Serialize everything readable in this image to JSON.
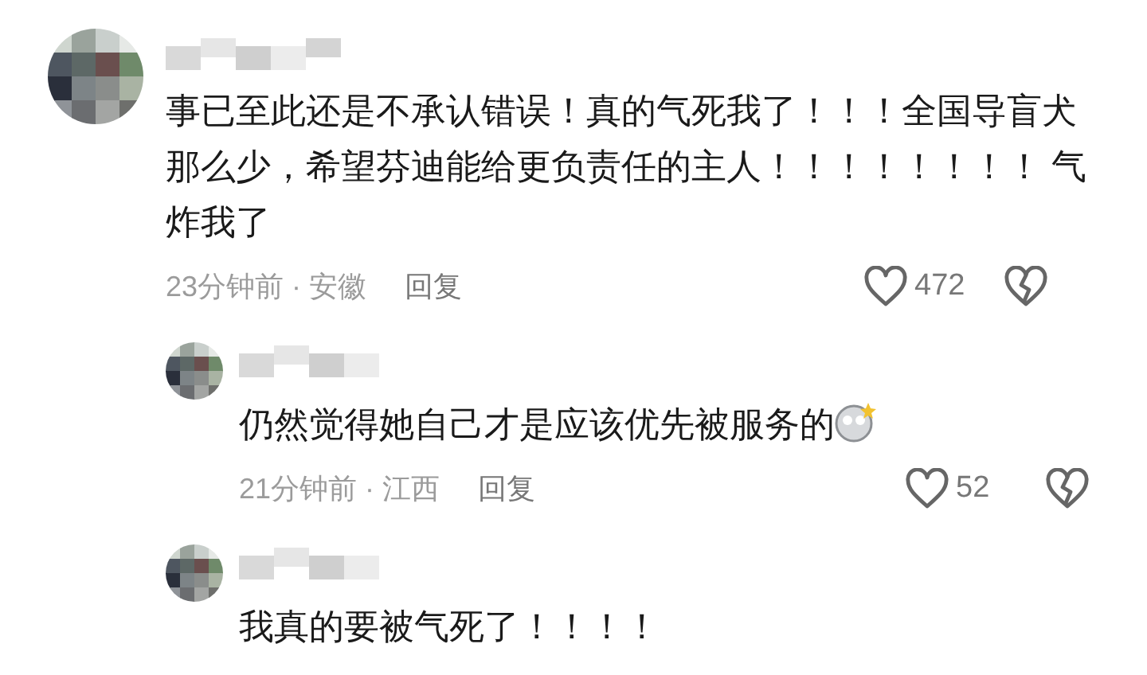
{
  "comments": [
    {
      "text": "事已至此还是不承认错误！真的气死我了！！！全国导盲犬那么少，希望芬迪能给更负责任的主人！！！！！！！！ 气炸我了",
      "meta": "23分钟前 · 安徽",
      "reply_label": "回复",
      "likes": "472",
      "replies": [
        {
          "text": "仍然觉得她自己才是应该优先被服务的",
          "has_emoji": true,
          "meta": "21分钟前 · 江西",
          "reply_label": "回复",
          "likes": "52"
        },
        {
          "text": "我真的要被气死了！！！！"
        }
      ]
    }
  ]
}
